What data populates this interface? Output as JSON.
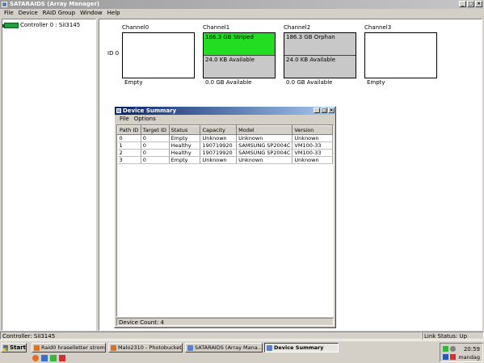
{
  "window": {
    "title": "SATARAIDS (Array Manager)"
  },
  "menu": [
    "File",
    "Device",
    "RAID Group",
    "Window",
    "Help"
  ],
  "tree": {
    "controller_label": "Controller 0 : SiI3145"
  },
  "main": {
    "id_label": "ID 0",
    "channels": [
      {
        "name": "Channel0",
        "type": "empty",
        "caption": "Empty"
      },
      {
        "name": "Channel1",
        "type": "split",
        "top_text": "186.3 GB Striped",
        "bottom_text": "24.0 KB Available",
        "caption": "0.0 GB Available"
      },
      {
        "name": "Channel2",
        "type": "split",
        "top_text": "186.3 GB Orphan",
        "bottom_text": "24.0 KB Available",
        "caption": "0.0 GB Available"
      },
      {
        "name": "Channel3",
        "type": "empty",
        "caption": "Empty"
      }
    ]
  },
  "dialog": {
    "title": "Device Summary",
    "menu": [
      "File",
      "Options"
    ],
    "columns": [
      "Path ID",
      "Target ID",
      "Status",
      "Capacity",
      "Model",
      "Version"
    ],
    "rows": [
      [
        "0",
        "0",
        "Empty",
        "Unknown",
        "Unknown",
        "Unknown"
      ],
      [
        "1",
        "0",
        "Healthy",
        "190719920",
        "SAMSUNG SP2004C",
        "VM100-33"
      ],
      [
        "2",
        "0",
        "Healthy",
        "190719920",
        "SAMSUNG SP2004C",
        "VM100-33"
      ],
      [
        "3",
        "0",
        "Empty",
        "Unknown",
        "Unknown",
        "Unknown"
      ]
    ],
    "status": "Device Count: 4"
  },
  "statusbar": {
    "left": "Controller: SiI3145",
    "right": "Link Status: Up"
  },
  "taskbar": {
    "start_label": "Start",
    "tasks": [
      {
        "label": "Raid0 hraselletter stromb...",
        "color": "#e07020"
      },
      {
        "label": "Malo2310 - Photobucket...",
        "color": "#e07020"
      },
      {
        "label": "SATARAIDS (Array Mana...",
        "color": "#5a7fd0"
      },
      {
        "label": "Device Summary",
        "color": "#5a7fd0"
      }
    ],
    "active_task_index": 3,
    "clock": "20:59",
    "day": "mandag"
  }
}
